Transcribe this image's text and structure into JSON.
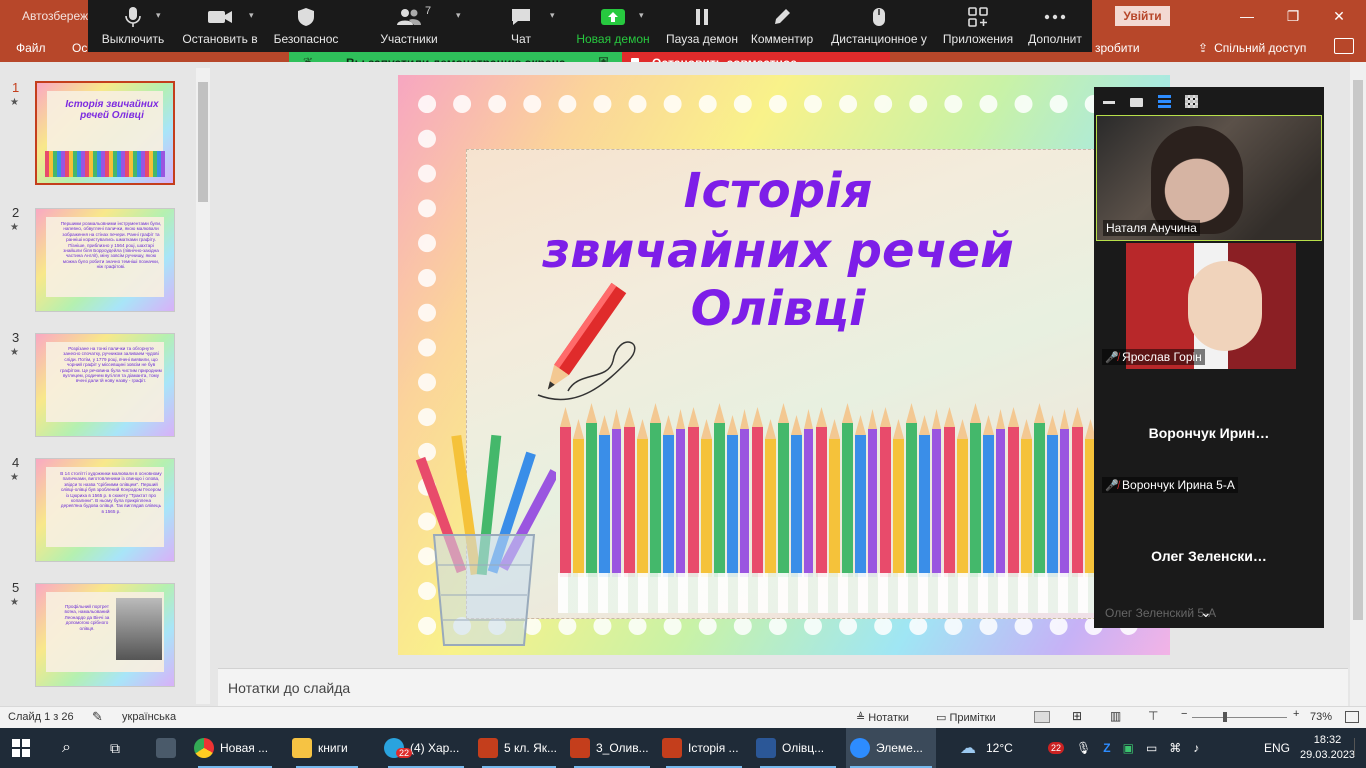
{
  "powerpoint": {
    "title_left": "Автозбереж",
    "signin": "Увійти",
    "tabs": [
      "Файл",
      "Основ"
    ],
    "tab_right_text": "зробити",
    "share": "Спільний доступ"
  },
  "zoom_toolbar": {
    "buttons": [
      {
        "label": "Выключить",
        "icon": "microphone-icon"
      },
      {
        "label": "Остановить в",
        "icon": "video-camera-icon"
      },
      {
        "label": "Безопаснос",
        "icon": "shield-icon"
      },
      {
        "label": "Участники",
        "icon": "participants-icon",
        "count": "7"
      },
      {
        "label": "Чат",
        "icon": "chat-icon"
      },
      {
        "label": "Новая демон",
        "icon": "share-screen-icon"
      },
      {
        "label": "Пауза демон",
        "icon": "pause-icon"
      },
      {
        "label": "Комментир",
        "icon": "annotate-pen-icon"
      },
      {
        "label": "Дистанционное у",
        "icon": "remote-control-icon"
      },
      {
        "label": "Приложения",
        "icon": "apps-icon"
      },
      {
        "label": "Дополнит",
        "icon": "more-icon"
      }
    ]
  },
  "share_banner": {
    "sharing_text": "Вы запустили демонстрацию экрана",
    "stop_text": "Остановить совместное использование"
  },
  "thumbnails": [
    {
      "num": "1",
      "text": "Історія звичайних речей Олівці"
    },
    {
      "num": "2",
      "text": "Першими розмальовними інструментами були, напевно, обвуглені палички, якою малювали зображення на стінах печери. Ранні графіт та ранніші користувались шматками графіту. Пізніше, приблизно у 1564 році, шахтарі знайшли біля Борроудейла (північно-західна частина Англії), міну зовсім ручнишу, якою можна було робити значно темніші позначки, ніж графітові."
    },
    {
      "num": "3",
      "text": "Розрізане на тонкі палички та обгорнуте занесно спочатку, ручником заливаем чудові сліди. Потім, у 1779 році, вчені виявили, що чорний графіт у міссевщині зовсім не був графітом. Це речовина була чистим природним вуглецем, родичем вугілля та діаманта, тому вчені дали їй нову назву - графіт."
    },
    {
      "num": "4",
      "text": "В 14 столітті художники малювали в основному паличками, виготовленими із свинцю і олова, звідси їх назва \"срібнимм олівцем\". Перший олівці-олівці був зроблений Конрадом Гесером із Цюриха в 1565 р. в сюжету \"Трактат про копалини\". В ньому була прикріплена дерев'яна будова олівця. Так виглядав олівець в 1565 р."
    },
    {
      "num": "5",
      "text": "Профільний портрет воїна, намальований Леонардо да Вінчі за допомогою срібного олівця."
    }
  ],
  "slide": {
    "title_line1": "Історія",
    "title_line2": "звичайних речей",
    "title_line3": "Олівці"
  },
  "participants": [
    {
      "name": "Наталя Анучина",
      "muted": false,
      "has_video": true
    },
    {
      "name": "Ярослав Горін",
      "muted": true,
      "has_video": true
    },
    {
      "name": "Ворончук Ирина 5-А",
      "display": "Ворончук  Ирин…",
      "muted": true,
      "has_video": false
    },
    {
      "name": "Олег Зеленский 5-А",
      "display": "Олег  Зеленски…",
      "muted": false,
      "has_video": false
    }
  ],
  "notes": {
    "placeholder": "Нотатки до слайда"
  },
  "statusbar": {
    "slide_info": "Слайд 1 з 26",
    "language": "українська",
    "notes_btn": "Нотатки",
    "comments_btn": "Примітки",
    "zoom": "73%"
  },
  "taskbar": {
    "apps": [
      {
        "label": "Новая ...",
        "icon": "chrome-icon"
      },
      {
        "label": "книги",
        "icon": "folder-icon"
      },
      {
        "label": "(4) Хар...",
        "icon": "telegram-icon",
        "badge": "22"
      },
      {
        "label": "5 кл. Як...",
        "icon": "powerpoint-icon"
      },
      {
        "label": "3_Олив...",
        "icon": "powerpoint-icon"
      },
      {
        "label": "Історія ...",
        "icon": "powerpoint-icon"
      },
      {
        "label": "Олівц...",
        "icon": "word-icon"
      },
      {
        "label": "Элеме...",
        "icon": "zoom-icon"
      }
    ],
    "weather": "12°C",
    "lang": "ENG",
    "time": "18:32",
    "date": "29.03.2023",
    "tray_badge": "22"
  },
  "colors": {
    "ppt_accent": "#b7472a",
    "zoom_green": "#27c93f",
    "stop_red": "#e02b2b",
    "slide_title": "#7d1ee8"
  }
}
